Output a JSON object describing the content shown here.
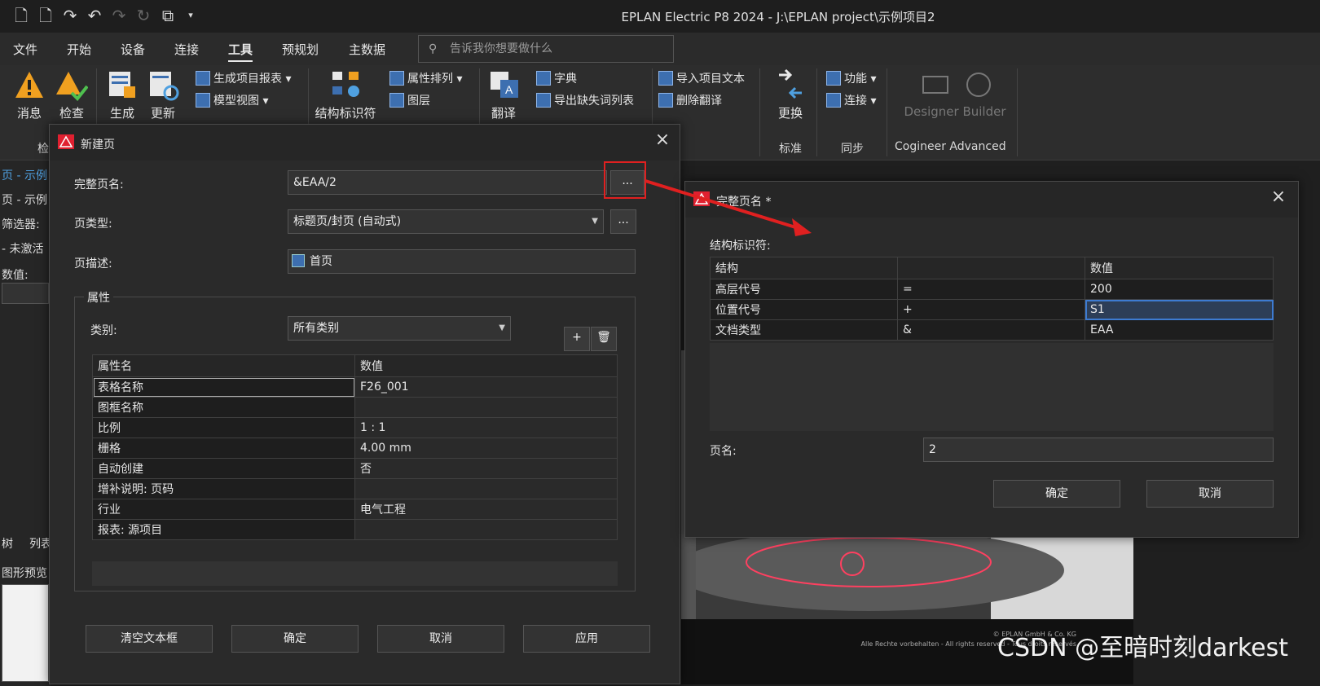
{
  "window": {
    "title": "EPLAN Electric P8 2024 - J:\\EPLAN project\\示例项目2"
  },
  "menu": {
    "items": [
      "文件",
      "开始",
      "设备",
      "连接",
      "工具",
      "预规划",
      "主数据"
    ],
    "active": "工具",
    "search_placeholder": "告诉我你想要做什么"
  },
  "ribbon": {
    "big_buttons": [
      "消息",
      "检查",
      "生成",
      "更新",
      "结构标识符",
      "翻译",
      "更换",
      "Designer Builder"
    ],
    "small_buttons": [
      "生成项目报表",
      "模型视图",
      "属性排列",
      "图层",
      "字典",
      "导出缺失词列表",
      "导入项目文本",
      "删除翻译",
      "功能",
      "连接"
    ],
    "groups": [
      "检",
      "标准",
      "同步",
      "Cogineer Advanced"
    ]
  },
  "left_panel": {
    "labels": [
      "页 - 示例",
      "页 - 示例",
      "筛选器:",
      "- 未激活",
      "数值:",
      "树",
      "列表",
      "图形预览"
    ]
  },
  "new_page_dialog": {
    "title": "新建页",
    "full_page_name_label": "完整页名:",
    "full_page_name_value": "&EAA/2",
    "page_type_label": "页类型:",
    "page_type_value": "标题页/封页 (自动式)",
    "page_desc_label": "页描述:",
    "page_desc_value": "首页",
    "properties_group": "属性",
    "category_label": "类别:",
    "category_value": "所有类别",
    "table_headers": [
      "属性名",
      "数值"
    ],
    "rows": [
      {
        "name": "表格名称",
        "value": "F26_001"
      },
      {
        "name": "图框名称",
        "value": ""
      },
      {
        "name": "比例",
        "value": "1 : 1"
      },
      {
        "name": "栅格",
        "value": "4.00 mm"
      },
      {
        "name": "自动创建",
        "value": "否"
      },
      {
        "name": "增补说明: 页码",
        "value": ""
      },
      {
        "name": "行业",
        "value": "电气工程"
      },
      {
        "name": "报表: 源项目",
        "value": ""
      }
    ],
    "buttons": {
      "clear": "清空文本框",
      "ok": "确定",
      "cancel": "取消",
      "apply": "应用"
    },
    "ellipsis": "..."
  },
  "full_name_dialog": {
    "title": "完整页名 *",
    "structure_label": "结构标识符:",
    "headers": [
      "结构",
      "",
      "数值"
    ],
    "rows": [
      {
        "structure": "高层代号",
        "prefix": "=",
        "value": "200"
      },
      {
        "structure": "位置代号",
        "prefix": "+",
        "value": "S1"
      },
      {
        "structure": "文档类型",
        "prefix": "&",
        "value": "EAA"
      }
    ],
    "page_name_label": "页名:",
    "page_name_value": "2",
    "buttons": {
      "ok": "确定",
      "cancel": "取消"
    }
  },
  "background": {
    "copyright": "© EPLAN GmbH & Co. KG",
    "rights": "Alle Rechte vorbehalten - All rights reserved - Tous droits réservés"
  },
  "watermark": "CSDN @至暗时刻darkest",
  "colors": {
    "accent_red": "#e02020",
    "selection_blue": "#3d7bd1"
  }
}
